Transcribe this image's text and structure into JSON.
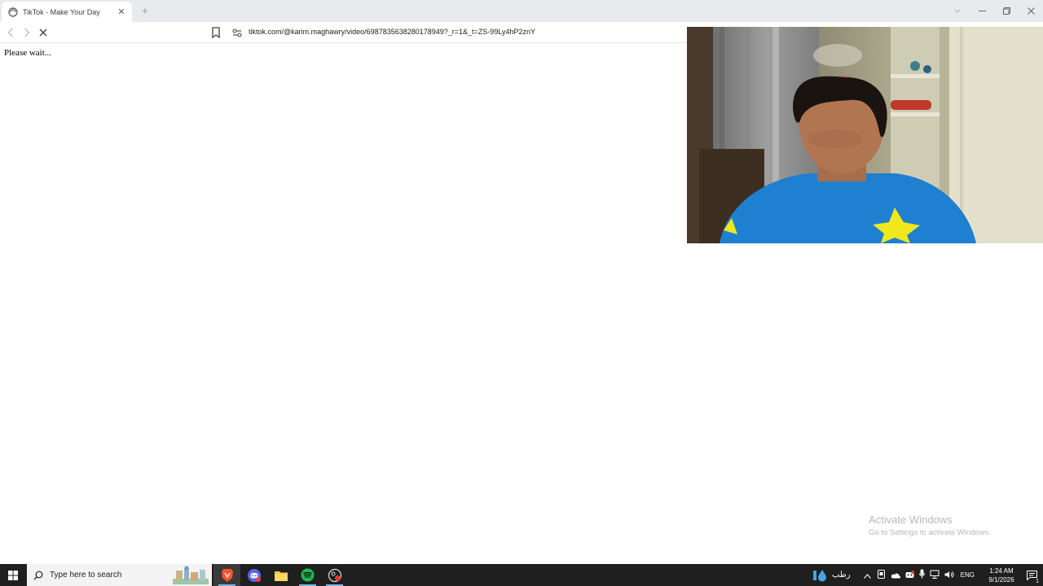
{
  "browser": {
    "tab_title": "TikTok - Make Your Day",
    "url": "tiktok.com/@karim.maghawry/video/6987835638280178949?_r=1&_t=ZS-99Ly4hP2znY"
  },
  "page": {
    "status_text": "Please wait..."
  },
  "watermark": {
    "title": "Activate Windows",
    "subtitle": "Go to Settings to activate Windows."
  },
  "taskbar": {
    "search_placeholder": "Type here to search",
    "weather_text": "رطب",
    "language": "ENG",
    "time": "1:24 AM",
    "date": "9/1/2026",
    "notification_count": "1"
  },
  "colors": {
    "taskbar_bg": "#1f1f1f",
    "spotify": "#1db954",
    "brave": "#fb542b",
    "accent": "#76b9ed"
  }
}
